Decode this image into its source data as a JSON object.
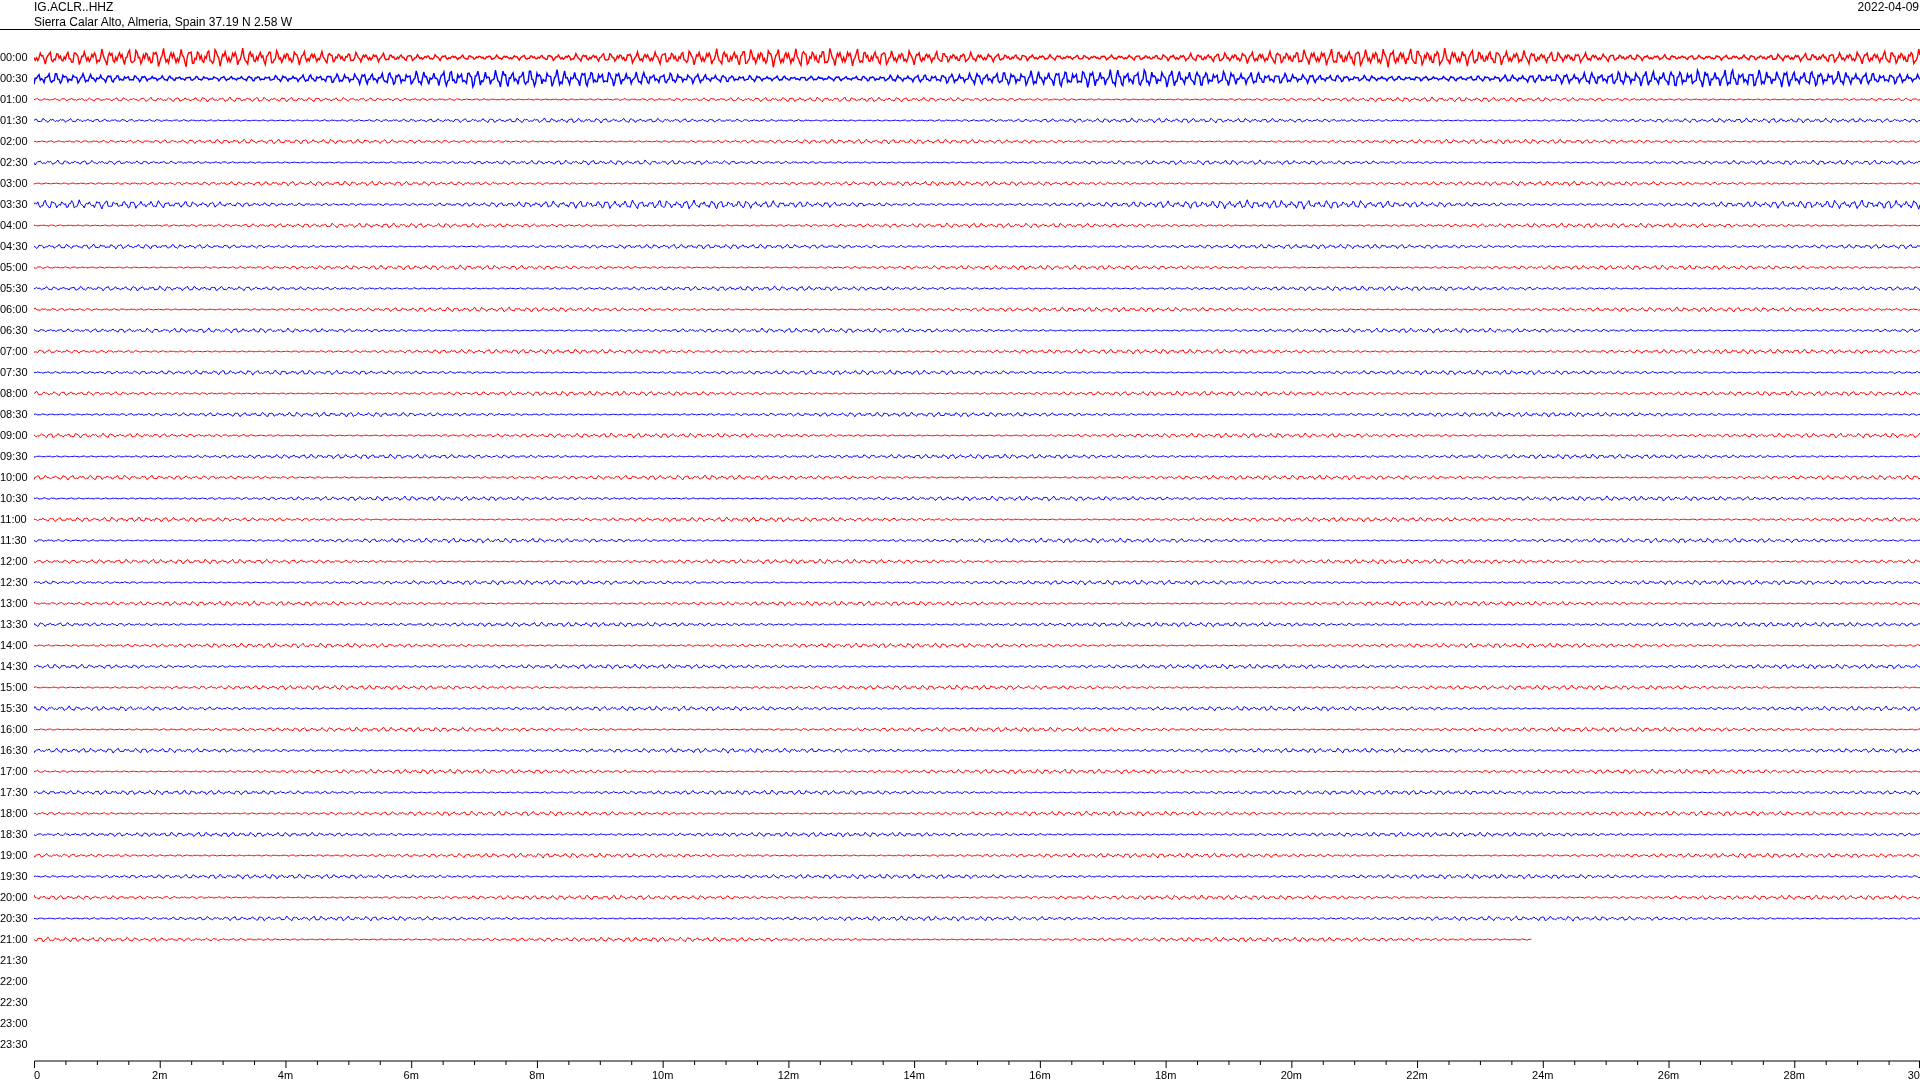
{
  "header": {
    "station": "IG.ACLR..HHZ",
    "location": "Sierra Calar Alto, Almeria, Spain  37.19 N 2.58 W",
    "date": "2022-04-09"
  },
  "rows": [
    {
      "label": "00:00",
      "color": "#ff0000",
      "level": 1
    },
    {
      "label": "00:30",
      "color": "#0000ff",
      "level": 1
    },
    {
      "label": "01:00",
      "color": "#ff0000",
      "level": 1
    },
    {
      "label": "01:30",
      "color": "#0000ff",
      "level": 1
    },
    {
      "label": "02:00",
      "color": "#ff0000",
      "level": 1
    },
    {
      "label": "02:30",
      "color": "#0000ff",
      "level": 1
    },
    {
      "label": "03:00",
      "color": "#ff0000",
      "level": 1
    },
    {
      "label": "03:30",
      "color": "#0000ff",
      "level": 1
    },
    {
      "label": "04:00",
      "color": "#ff0000",
      "level": 1
    },
    {
      "label": "04:30",
      "color": "#0000ff",
      "level": 1
    },
    {
      "label": "05:00",
      "color": "#ff0000",
      "level": 1
    },
    {
      "label": "05:30",
      "color": "#0000ff",
      "level": 1
    },
    {
      "label": "06:00",
      "color": "#ff0000",
      "level": 1
    },
    {
      "label": "06:30",
      "color": "#0000ff",
      "level": 1
    },
    {
      "label": "07:00",
      "color": "#ff0000",
      "level": 1
    },
    {
      "label": "07:30",
      "color": "#0000ff",
      "level": 1
    },
    {
      "label": "08:00",
      "color": "#ff0000",
      "level": 1
    },
    {
      "label": "08:30",
      "color": "#0000ff",
      "level": 1
    },
    {
      "label": "09:00",
      "color": "#ff0000",
      "level": 1
    },
    {
      "label": "09:30",
      "color": "#0000ff",
      "level": 1
    },
    {
      "label": "10:00",
      "color": "#ff0000",
      "level": 1
    },
    {
      "label": "10:30",
      "color": "#0000ff",
      "level": 1
    },
    {
      "label": "11:00",
      "color": "#ff0000",
      "level": 1
    },
    {
      "label": "11:30",
      "color": "#0000ff",
      "level": 1
    },
    {
      "label": "12:00",
      "color": "#ff0000",
      "level": 1
    },
    {
      "label": "12:30",
      "color": "#0000ff",
      "level": 1
    },
    {
      "label": "13:00",
      "color": "#ff0000",
      "level": 1
    },
    {
      "label": "13:30",
      "color": "#0000ff",
      "level": 1
    },
    {
      "label": "14:00",
      "color": "#ff0000",
      "level": 1
    },
    {
      "label": "14:30",
      "color": "#0000ff",
      "level": 1
    },
    {
      "label": "15:00",
      "color": "#ff0000",
      "level": 1
    },
    {
      "label": "15:30",
      "color": "#0000ff",
      "level": 1
    },
    {
      "label": "16:00",
      "color": "#ff0000",
      "level": 1
    },
    {
      "label": "16:30",
      "color": "#0000ff",
      "level": 1
    },
    {
      "label": "17:00",
      "color": "#ff0000",
      "level": 1
    },
    {
      "label": "17:30",
      "color": "#0000ff",
      "level": 1
    },
    {
      "label": "18:00",
      "color": "#ff0000",
      "level": 1
    },
    {
      "label": "18:30",
      "color": "#0000ff",
      "level": 1
    },
    {
      "label": "19:00",
      "color": "#ff0000",
      "level": 1
    },
    {
      "label": "19:30",
      "color": "#0000ff",
      "level": 1
    },
    {
      "label": "20:00",
      "color": "#ff0000",
      "level": 1
    },
    {
      "label": "20:30",
      "color": "#0000ff",
      "level": 1
    },
    {
      "label": "21:00",
      "color": "#ff0000",
      "level": 0.794
    },
    {
      "label": "21:30"
    },
    {
      "label": "22:00"
    },
    {
      "label": "22:30"
    },
    {
      "label": "23:00"
    },
    {
      "label": "23:30"
    }
  ],
  "axis": {
    "labels": [
      "0",
      "2m",
      "4m",
      "6m",
      "8m",
      "10m",
      "12m",
      "14m",
      "16m",
      "18m",
      "20m",
      "22m",
      "24m",
      "26m",
      "28m",
      "30"
    ]
  }
}
